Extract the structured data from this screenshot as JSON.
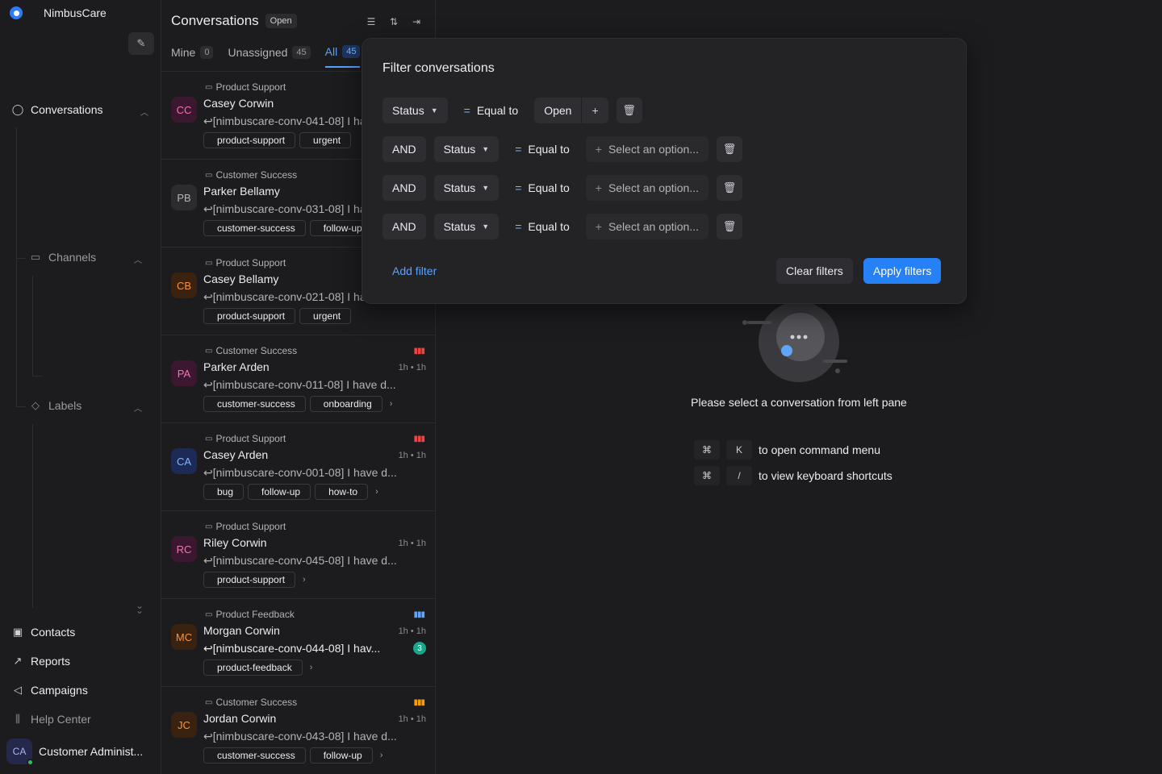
{
  "brand": {
    "name": "NimbusCare"
  },
  "sidebar": {
    "conversations": "Conversations",
    "channels": "Channels",
    "labels": "Labels",
    "contacts": "Contacts",
    "reports": "Reports",
    "campaigns": "Campaigns",
    "help_center": "Help Center",
    "profile": {
      "initials": "CA",
      "name": "Customer Administ..."
    }
  },
  "conversations": {
    "title": "Conversations",
    "status_badge": "Open",
    "tabs": [
      {
        "label": "Mine",
        "count": "0"
      },
      {
        "label": "Unassigned",
        "count": "45"
      },
      {
        "label": "All",
        "count": "45"
      }
    ],
    "items": [
      {
        "inbox": "Product Support",
        "initials": "CC",
        "name": "Casey Corwin",
        "preview": "[nimbuscare-conv-041-08] I have d...",
        "tags": [
          "product-support",
          "urgent"
        ],
        "time": "",
        "priority": ""
      },
      {
        "inbox": "Customer Success",
        "initials": "PB",
        "name": "Parker Bellamy",
        "preview": "[nimbuscare-conv-031-08] I have d...",
        "tags": [
          "customer-success",
          "follow-up"
        ],
        "time": "",
        "priority": ""
      },
      {
        "inbox": "Product Support",
        "initials": "CB",
        "name": "Casey Bellamy",
        "preview": "[nimbuscare-conv-021-08] I have d...",
        "tags": [
          "product-support",
          "urgent"
        ],
        "time": "",
        "priority": ""
      },
      {
        "inbox": "Customer Success",
        "initials": "PA",
        "name": "Parker Arden",
        "preview": "[nimbuscare-conv-011-08] I have d...",
        "tags": [
          "customer-success",
          "onboarding"
        ],
        "time": "1h • 1h",
        "priority": "urgent"
      },
      {
        "inbox": "Product Support",
        "initials": "CA",
        "name": "Casey Arden",
        "preview": "[nimbuscare-conv-001-08] I have d...",
        "tags": [
          "bug",
          "follow-up",
          "how-to"
        ],
        "time": "1h • 1h",
        "priority": "urgent"
      },
      {
        "inbox": "Product Support",
        "initials": "RC",
        "name": "Riley Corwin",
        "preview": "[nimbuscare-conv-045-08] I have d...",
        "tags": [
          "product-support"
        ],
        "time": "1h • 1h",
        "priority": ""
      },
      {
        "inbox": "Product Feedback",
        "initials": "MC",
        "name": "Morgan Corwin",
        "preview": "[nimbuscare-conv-044-08] I hav...",
        "tags": [
          "product-feedback"
        ],
        "time": "1h • 1h",
        "priority": "low",
        "unread": "3"
      },
      {
        "inbox": "Customer Success",
        "initials": "JC",
        "name": "Jordan Corwin",
        "preview": "[nimbuscare-conv-043-08] I have d...",
        "tags": [
          "customer-success",
          "follow-up"
        ],
        "time": "1h • 1h",
        "priority": "medium"
      }
    ]
  },
  "filter": {
    "title": "Filter conversations",
    "rows": [
      {
        "connector": "",
        "attribute": "Status",
        "operator": "Equal to",
        "value": "Open"
      },
      {
        "connector": "AND",
        "attribute": "Status",
        "operator": "Equal to",
        "placeholder": "Select an option..."
      },
      {
        "connector": "AND",
        "attribute": "Status",
        "operator": "Equal to",
        "placeholder": "Select an option..."
      },
      {
        "connector": "AND",
        "attribute": "Status",
        "operator": "Equal to",
        "placeholder": "Select an option..."
      }
    ],
    "add_filter": "Add filter",
    "clear": "Clear filters",
    "apply": "Apply filters"
  },
  "empty_state": {
    "message": "Please select a conversation from left pane",
    "shortcuts": [
      {
        "mod": "⌘",
        "key": "K",
        "label": "to open command menu"
      },
      {
        "mod": "⌘",
        "key": "/",
        "label": "to view keyboard shortcuts"
      }
    ]
  },
  "colors": {
    "accent": "#2781f6",
    "link": "#5aa2ff",
    "unread": "#17a88c",
    "urgent": "#ef4444",
    "medium": "#f59e0b",
    "low": "#60a5fa"
  }
}
